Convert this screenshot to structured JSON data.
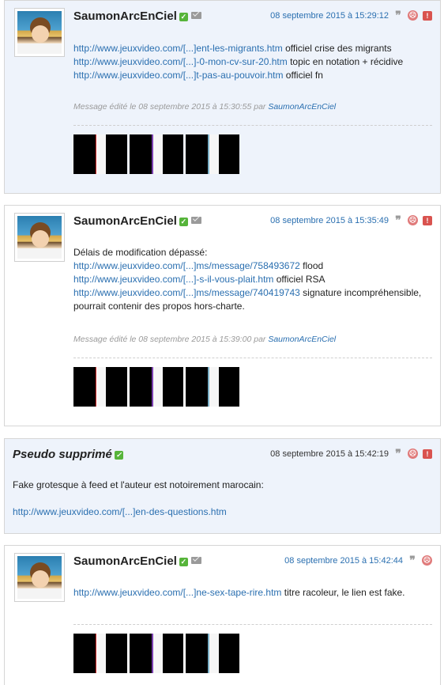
{
  "posts": [
    {
      "author": "SaumonArcEnCiel",
      "date": "08 septembre 2015 à 15:29:12",
      "lines": [
        {
          "link": "http://www.jeuxvideo.com/[...]ent-les-migrants.htm",
          "text": " officiel crise des migrants"
        },
        {
          "link": "http://www.jeuxvideo.com/[...]-0-mon-cv-sur-20.htm",
          "text": " topic en notation + récidive"
        },
        {
          "link": "http://www.jeuxvideo.com/[...]t-pas-au-pouvoir.htm",
          "text": " officiel fn"
        }
      ],
      "edited_prefix": "Message édité le 08 septembre 2015 à 15:30:55 par ",
      "edited_by": "SaumonArcEnCiel"
    },
    {
      "author": "SaumonArcEnCiel",
      "date": "08 septembre 2015 à 15:35:49",
      "intro": "Délais de modification dépassé:",
      "lines": [
        {
          "link": "http://www.jeuxvideo.com/[...]ms/message/758493672",
          "text": " flood"
        },
        {
          "link": "http://www.jeuxvideo.com/[...]-s-il-vous-plait.htm",
          "text": " officiel RSA"
        },
        {
          "link": "http://www.jeuxvideo.com/[...]ms/message/740419743",
          "text": " signature incompréhensible,"
        }
      ],
      "continuation": "pourrait contenir des propos hors-charte.",
      "edited_prefix": "Message édité le 08 septembre 2015 à 15:39:00 par ",
      "edited_by": "SaumonArcEnCiel"
    },
    {
      "author": "Pseudo supprimé",
      "date": "08 septembre 2015 à 15:42:19",
      "text": "Fake grotesque à feed et l'auteur est notoirement marocain:",
      "link": "http://www.jeuxvideo.com/[...]en-des-questions.htm"
    },
    {
      "author": "SaumonArcEnCiel",
      "date": "08 septembre 2015 à 15:42:44",
      "lines": [
        {
          "link": "http://www.jeuxvideo.com/[...]ne-sex-tape-rire.htm",
          "text": " titre racoleur, le lien est fake."
        }
      ]
    }
  ],
  "icons": {
    "verified": "verified-icon",
    "mail": "mail-icon",
    "quote": "quote-icon",
    "sad": "sad-face-icon",
    "alert": "alert-icon"
  },
  "colors": {
    "link": "#2a6fb0",
    "post_alt_bg": "#eef3fb",
    "border": "#d6d6d6"
  }
}
